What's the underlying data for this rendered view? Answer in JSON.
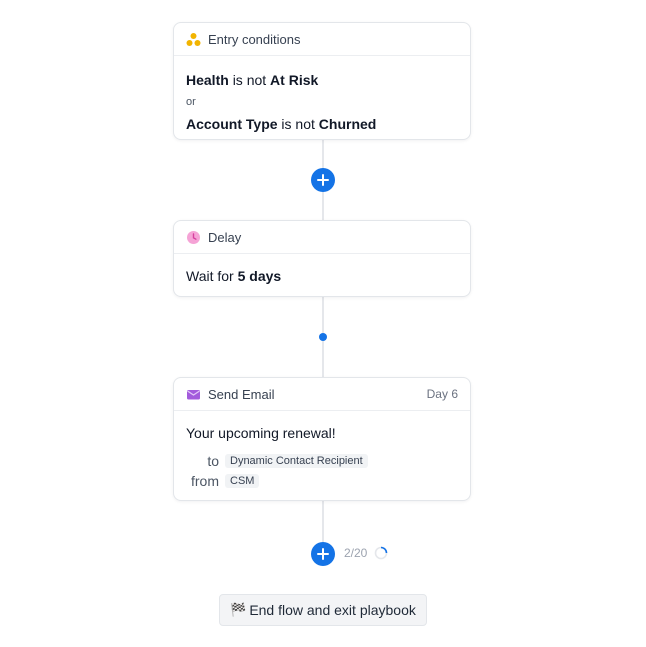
{
  "entry": {
    "title": "Entry conditions",
    "cond1": {
      "field": "Health",
      "op": "is not",
      "value": "At Risk"
    },
    "joiner": "or",
    "cond2": {
      "field": "Account Type",
      "op": "is not",
      "value": "Churned"
    }
  },
  "delay": {
    "title": "Delay",
    "prefix": "Wait for",
    "value": "5 days"
  },
  "email": {
    "title": "Send Email",
    "day": "Day 6",
    "subject": "Your upcoming renewal!",
    "to_label": "to",
    "to_value": "Dynamic Contact Recipient",
    "from_label": "from",
    "from_value": "CSM"
  },
  "footer": {
    "counter": "2/20",
    "end_button": "End flow and exit playbook"
  },
  "icons": {
    "entry": "nodes-icon",
    "delay": "clock-icon",
    "email": "envelope-icon",
    "add": "plus-icon",
    "end": "checkered-flag-icon"
  },
  "colors": {
    "accent": "#1473e6",
    "entry_icon": "#f2b400",
    "delay_icon": "#ec77c1",
    "email_icon": "#a35bdc"
  }
}
